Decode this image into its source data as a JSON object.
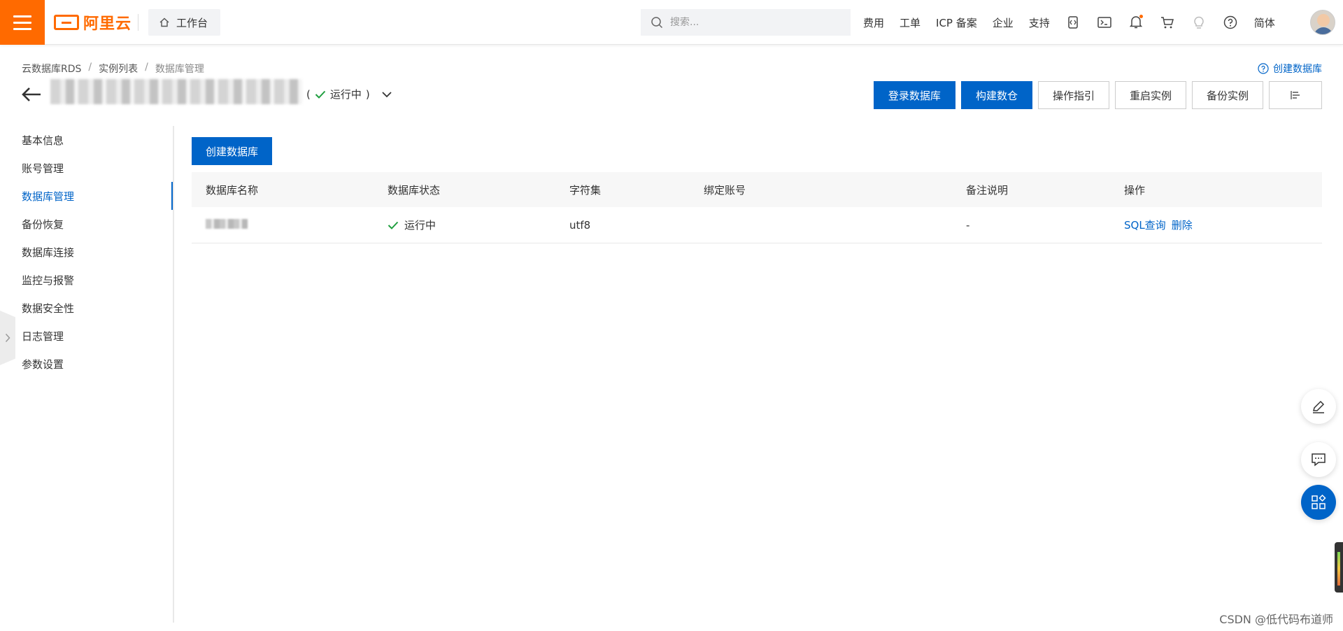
{
  "topbar": {
    "logo_text": "阿里云",
    "workbench_label": "工作台",
    "search_placeholder": "搜索...",
    "links": [
      "费用",
      "工单",
      "ICP 备案",
      "企业",
      "支持"
    ],
    "language": "简体",
    "brand_color": "#ff6a00"
  },
  "header": {
    "breadcrumb": [
      "云数据库RDS",
      "实例列表",
      "数据库管理"
    ],
    "help_link": "创建数据库",
    "status_open": "(",
    "status_text": "运行中",
    "status_close": ")",
    "buttons": {
      "login": "登录数据库",
      "build_warehouse": "构建数仓",
      "guide": "操作指引",
      "restart": "重启实例",
      "backup": "备份实例"
    }
  },
  "sidenav": {
    "items": [
      "基本信息",
      "账号管理",
      "数据库管理",
      "备份恢复",
      "数据库连接",
      "监控与报警",
      "数据安全性",
      "日志管理",
      "参数设置"
    ],
    "active": "数据库管理"
  },
  "content": {
    "create_button": "创建数据库",
    "columns": [
      "数据库名称",
      "数据库状态",
      "字符集",
      "绑定账号",
      "备注说明",
      "操作"
    ],
    "rows": [
      {
        "status": "运行中",
        "charset": "utf8",
        "account": "",
        "remark": "-",
        "actions": [
          "SQL查询",
          "删除"
        ]
      }
    ]
  },
  "watermark": "CSDN @低代码布道师",
  "accent_color": "#0064c8",
  "success_color": "#1e9e3e"
}
